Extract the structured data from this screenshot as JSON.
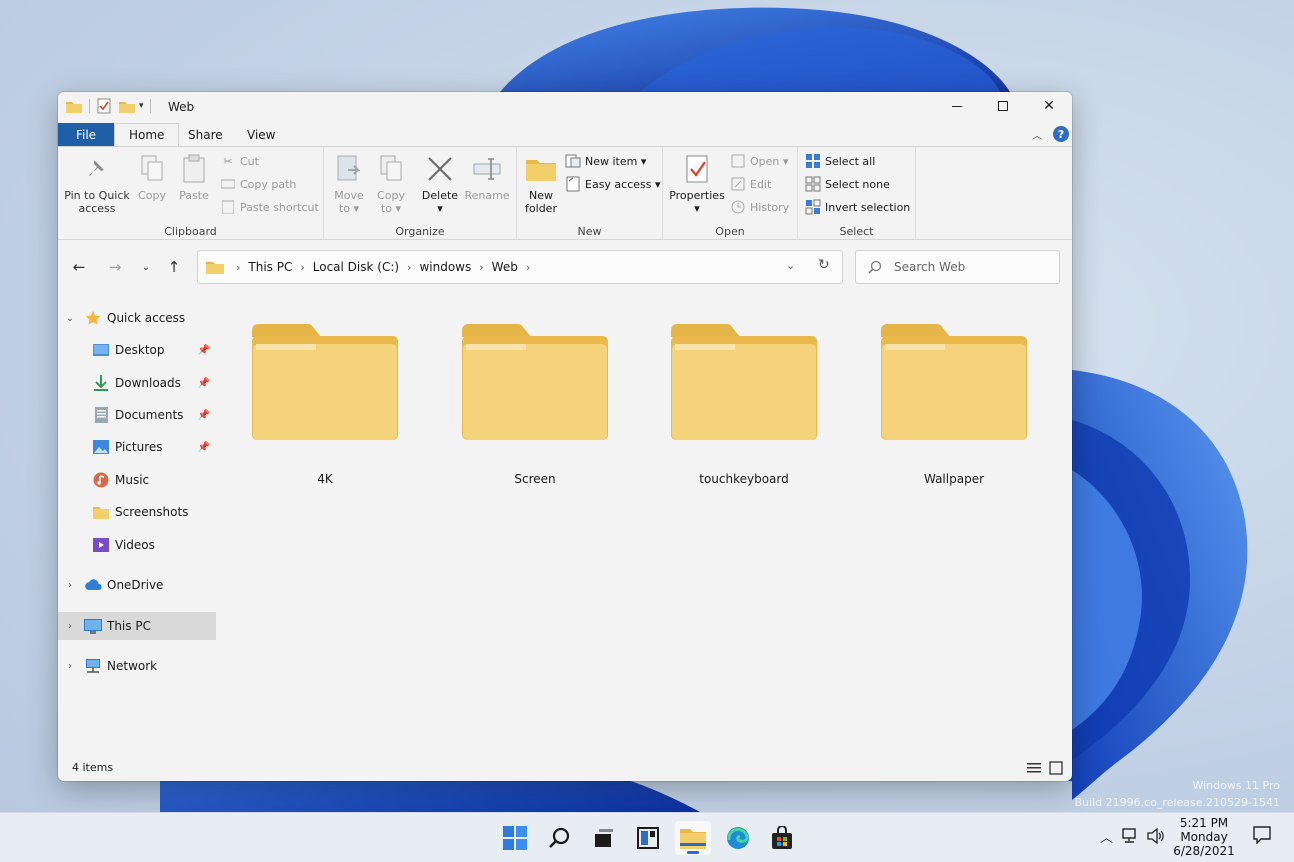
{
  "desktop": {
    "watermark_line1": "Windows 11 Pro",
    "watermark_line2": "Build 21996.co_release.210529-1541"
  },
  "window": {
    "title": "Web",
    "controls": {
      "minimize": "—",
      "maximize": "☐",
      "close": "✕"
    }
  },
  "ribbon_tabs": [
    {
      "label": "File"
    },
    {
      "label": "Home"
    },
    {
      "label": "Share"
    },
    {
      "label": "View"
    }
  ],
  "ribbon": {
    "clipboard": {
      "label": "Clipboard",
      "pin": "Pin to Quick access",
      "pin_l1": "Pin to Quick",
      "pin_l2": "access",
      "copy": "Copy",
      "paste": "Paste",
      "cut": "Cut",
      "copy_path": "Copy path",
      "paste_shortcut": "Paste shortcut"
    },
    "organize": {
      "label": "Organize",
      "move_l1": "Move",
      "move_l2": "to ▾",
      "copy_l1": "Copy",
      "copy_l2": "to ▾",
      "delete_l1": "Delete",
      "delete_l2": "▾",
      "rename": "Rename"
    },
    "new": {
      "label": "New",
      "folder_l1": "New",
      "folder_l2": "folder",
      "new_item": "New item ▾",
      "easy_access": "Easy access ▾"
    },
    "open": {
      "label": "Open",
      "properties_l1": "Properties",
      "properties_l2": "▾",
      "open": "Open ▾",
      "edit": "Edit",
      "history": "History"
    },
    "select": {
      "label": "Select",
      "select_all": "Select all",
      "select_none": "Select none",
      "invert": "Invert selection"
    }
  },
  "address": {
    "crumbs": [
      "This PC",
      "Local Disk (C:)",
      "windows",
      "Web"
    ],
    "search_placeholder": "Search Web"
  },
  "nav": {
    "quick_access": "Quick access",
    "items": [
      {
        "label": "Desktop",
        "pinned": true
      },
      {
        "label": "Downloads",
        "pinned": true
      },
      {
        "label": "Documents",
        "pinned": true
      },
      {
        "label": "Pictures",
        "pinned": true
      },
      {
        "label": "Music",
        "pinned": false
      },
      {
        "label": "Screenshots",
        "pinned": false
      },
      {
        "label": "Videos",
        "pinned": false
      }
    ],
    "onedrive": "OneDrive",
    "this_pc": "This PC",
    "network": "Network"
  },
  "folders": [
    "4K",
    "Screen",
    "touchkeyboard",
    "Wallpaper"
  ],
  "status": {
    "item_count": "4 items"
  },
  "taskbar": {
    "time": "5:21 PM",
    "day": "Monday",
    "date": "6/28/2021"
  },
  "colors": {
    "file_tab": "#1f5fa7",
    "folder_yellow": "#f3cf6b",
    "accent": "#2d6dc4"
  }
}
